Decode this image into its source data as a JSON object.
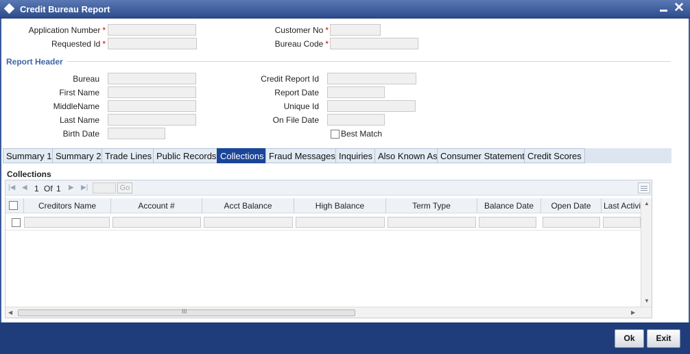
{
  "window": {
    "title": "Credit Bureau Report"
  },
  "fields": {
    "application_number": {
      "label": "Application Number",
      "required": "*",
      "value": ""
    },
    "requested_id": {
      "label": "Requested Id",
      "required": "*",
      "value": ""
    },
    "customer_no": {
      "label": "Customer No",
      "required": "*",
      "value": ""
    },
    "bureau_code": {
      "label": "Bureau Code",
      "required": "*",
      "value": ""
    }
  },
  "report_header": {
    "title": "Report Header",
    "bureau": {
      "label": "Bureau",
      "value": ""
    },
    "first_name": {
      "label": "First Name",
      "value": ""
    },
    "middle_name": {
      "label": "MiddleName",
      "value": ""
    },
    "last_name": {
      "label": "Last Name",
      "value": ""
    },
    "birth_date": {
      "label": "Birth Date",
      "value": ""
    },
    "credit_report_id": {
      "label": "Credit Report Id",
      "value": ""
    },
    "report_date": {
      "label": "Report Date",
      "value": ""
    },
    "unique_id": {
      "label": "Unique Id",
      "value": ""
    },
    "on_file_date": {
      "label": "On File Date",
      "value": ""
    },
    "best_match": {
      "label": "Best Match",
      "checked": false
    }
  },
  "tabs": [
    {
      "label": "Summary 1"
    },
    {
      "label": "Summary 2"
    },
    {
      "label": "Trade Lines"
    },
    {
      "label": "Public Records"
    },
    {
      "label": "Collections",
      "active": true
    },
    {
      "label": "Fraud Messages"
    },
    {
      "label": "Inquiries"
    },
    {
      "label": "Also Known As"
    },
    {
      "label": "Consumer Statement"
    },
    {
      "label": "Credit Scores"
    }
  ],
  "collections": {
    "title": "Collections",
    "pager": {
      "current": "1",
      "of_label": "Of",
      "total": "1",
      "go_label": "Go"
    },
    "columns": [
      "Creditors Name",
      "Account #",
      "Acct Balance",
      "High Balance",
      "Term Type",
      "Balance Date",
      "Open Date",
      "Last Activi"
    ],
    "scroll_grip": "III"
  },
  "buttons": {
    "ok": "Ok",
    "exit": "Exit"
  },
  "colors": {
    "titlebar": "#2d4c8c",
    "active_tab": "#1b4598",
    "footer": "#1f3d7a",
    "section_title": "#3d64a8",
    "required": "#cc0000"
  }
}
